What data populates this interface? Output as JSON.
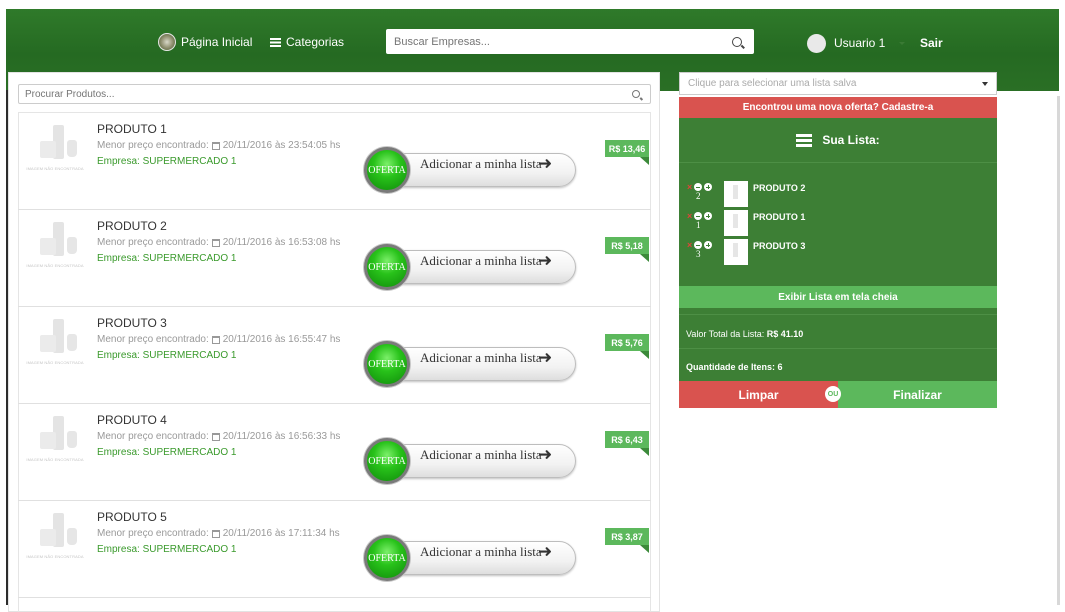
{
  "header": {
    "home_label": "Página Inicial",
    "categories_label": "Categorias",
    "search_placeholder": "Buscar Empresas...",
    "user_label": "Usuario 1",
    "logout_label": "Sair"
  },
  "products_search": {
    "placeholder": "Procurar Produtos..."
  },
  "product_common": {
    "no_image_caption": "IMAGEM NÃO ENCONTRADA",
    "price_found_prefix": "Menor preço encontrado:",
    "offer_badge": "OFERTA",
    "add_to_list_label": "Adicionar a minha lista"
  },
  "products": [
    {
      "name": "PRODUTO 1",
      "date": "20/11/2016 às 23:54:05 hs",
      "company": "Empresa: SUPERMERCADO 1",
      "price": "R$ 13,46"
    },
    {
      "name": "PRODUTO 2",
      "date": "20/11/2016 às 16:53:08 hs",
      "company": "Empresa: SUPERMERCADO 1",
      "price": "R$ 5,18"
    },
    {
      "name": "PRODUTO 3",
      "date": "20/11/2016 às 16:55:47 hs",
      "company": "Empresa: SUPERMERCADO 1",
      "price": "R$ 5,76"
    },
    {
      "name": "PRODUTO 4",
      "date": "20/11/2016 às 16:56:33 hs",
      "company": "Empresa: SUPERMERCADO 1",
      "price": "R$ 6,43"
    },
    {
      "name": "PRODUTO 5",
      "date": "20/11/2016 às 17:11:34 hs",
      "company": "Empresa: SUPERMERCADO 1",
      "price": "R$ 3,87"
    }
  ],
  "sidebar": {
    "saved_list_placeholder": "Clique para selecionar uma lista salva",
    "new_offer_label": "Encontrou uma nova oferta? Cadastre-a",
    "list_title": "Sua Lista:",
    "list_items": [
      {
        "qty": "2",
        "name": "PRODUTO 2"
      },
      {
        "qty": "1",
        "name": "PRODUTO 1"
      },
      {
        "qty": "3",
        "name": "PRODUTO 3"
      }
    ],
    "remove_symbol": "×",
    "fullscreen_label": "Exibir Lista em tela cheia",
    "total_label": "Valor Total da Lista:",
    "total_value": "R$ 41.10",
    "quantity_label": "Quantidade de Itens: 6",
    "clear_label": "Limpar",
    "or_label": "OU",
    "finish_label": "Finalizar"
  },
  "colors": {
    "header_green": "#2f7a2a",
    "panel_green": "#3d7f35",
    "accent_green": "#5cb85c",
    "danger_red": "#d9534f"
  }
}
